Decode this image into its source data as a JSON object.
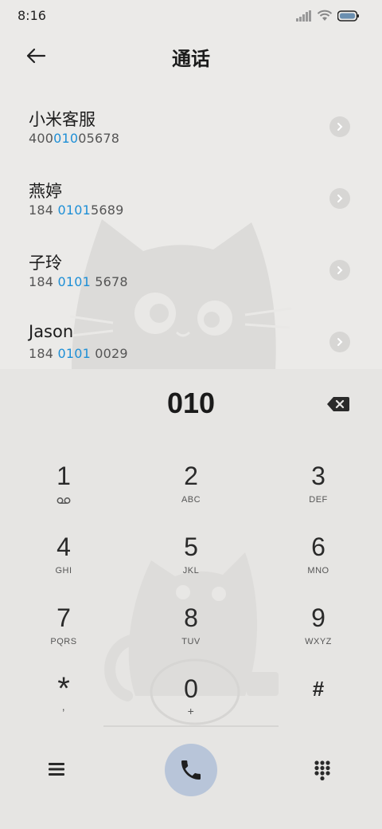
{
  "status_bar": {
    "time": "8:16"
  },
  "header": {
    "title": "通话"
  },
  "results": [
    {
      "name": "小米客服",
      "number_parts": [
        "400",
        "010",
        "05678"
      ]
    },
    {
      "name": "燕婷",
      "number_parts": [
        "184 ",
        "0101",
        "5689"
      ]
    },
    {
      "name": "子玲",
      "number_parts": [
        "184 ",
        "0101",
        " 5678"
      ]
    },
    {
      "name": "Jason",
      "number_parts": [
        "184 ",
        "0101",
        " 0029"
      ]
    }
  ],
  "dialer": {
    "input_value": "010",
    "keys": [
      {
        "digit": "1",
        "letters": ""
      },
      {
        "digit": "2",
        "letters": "ABC"
      },
      {
        "digit": "3",
        "letters": "DEF"
      },
      {
        "digit": "4",
        "letters": "GHI"
      },
      {
        "digit": "5",
        "letters": "JKL"
      },
      {
        "digit": "6",
        "letters": "MNO"
      },
      {
        "digit": "7",
        "letters": "PQRS"
      },
      {
        "digit": "8",
        "letters": "TUV"
      },
      {
        "digit": "9",
        "letters": "WXYZ"
      },
      {
        "digit": "*",
        "letters": ","
      },
      {
        "digit": "0",
        "letters": "+"
      },
      {
        "digit": "#",
        "letters": ""
      }
    ]
  },
  "colors": {
    "highlight": "#1e8fd6",
    "call_button": "#b8c5d9",
    "background": "#ebeae8"
  },
  "icons": {
    "back": "arrow-left-icon",
    "detail": "chevron-right-icon",
    "backspace": "backspace-icon",
    "voicemail": "voicemail-icon",
    "menu": "hamburger-menu-icon",
    "call": "phone-icon",
    "keypad": "dialpad-icon"
  }
}
